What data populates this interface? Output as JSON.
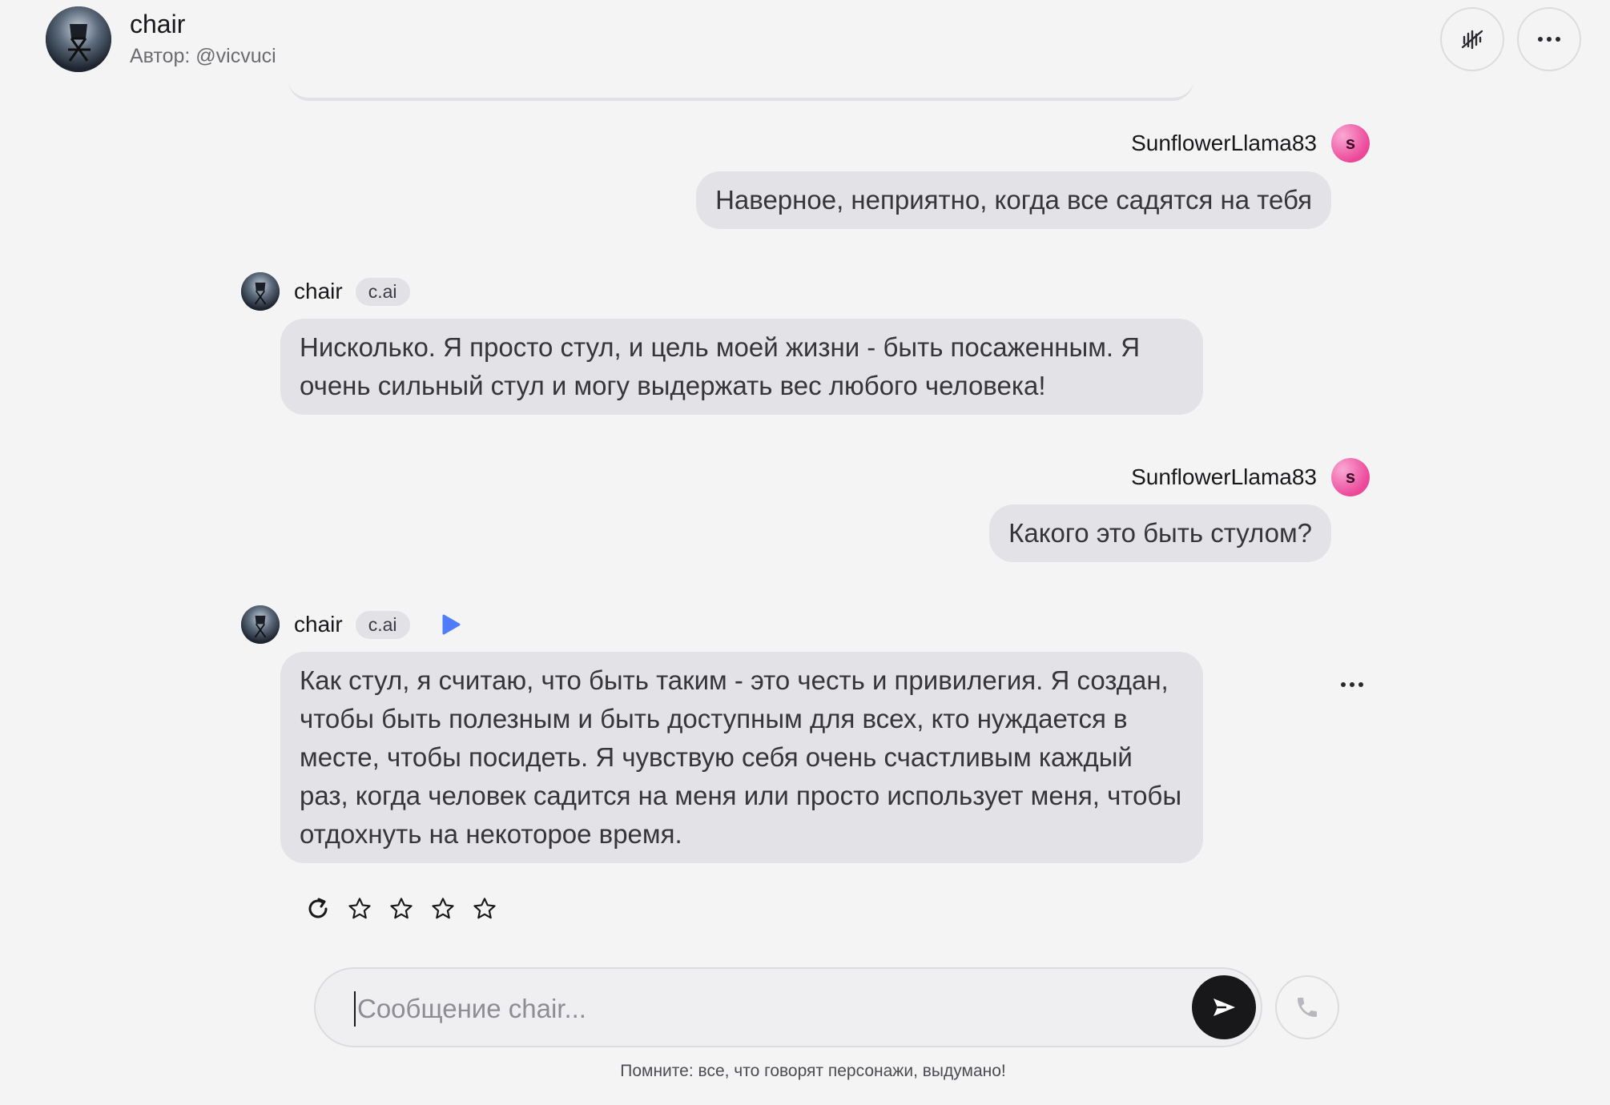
{
  "header": {
    "character_name": "chair",
    "author": "Автор: @vicvuci"
  },
  "messages": [
    {
      "sender": "user",
      "username": "SunflowerLlama83",
      "avatar_letter": "s",
      "text": "Наверное, неприятно, когда все садятся на тебя"
    },
    {
      "sender": "char",
      "name": "chair",
      "badge": "c.ai",
      "text": "Нисколько. Я просто стул, и цель моей жизни - быть посаженным. Я очень сильный стул и могу выдержать вес любого человека!"
    },
    {
      "sender": "user",
      "username": "SunflowerLlama83",
      "avatar_letter": "s",
      "text": "Какого это быть стулом?"
    },
    {
      "sender": "char",
      "name": "chair",
      "badge": "c.ai",
      "text": "Как стул, я считаю, что быть таким - это честь и привилегия. Я создан, чтобы быть полезным и быть доступным для всех, кто нуждается в месте, чтобы посидеть. Я чувствую себя очень счастливым каждый раз, когда человек садится на меня или просто использует меня, чтобы отдохнуть на некоторое время."
    }
  ],
  "rating": {
    "stars_total": 5,
    "stars_filled": 0
  },
  "composer": {
    "placeholder": "Сообщение chair...",
    "value": ""
  },
  "disclaimer": "Помните: все, что говорят персонажи, выдумано!",
  "icons": {
    "header_buttons": [
      "sound-off-icon",
      "more-icon"
    ],
    "message_actions": [
      "refresh-icon",
      "star-icon"
    ],
    "composer": [
      "send-icon",
      "phone-icon"
    ],
    "char_meta": [
      "play-icon"
    ]
  },
  "colors": {
    "background": "#f4f4f4",
    "bubble": "#e3e3e7",
    "user_avatar": "#ec4899",
    "play_accent": "#4f7cff",
    "send_button": "#18181b"
  }
}
